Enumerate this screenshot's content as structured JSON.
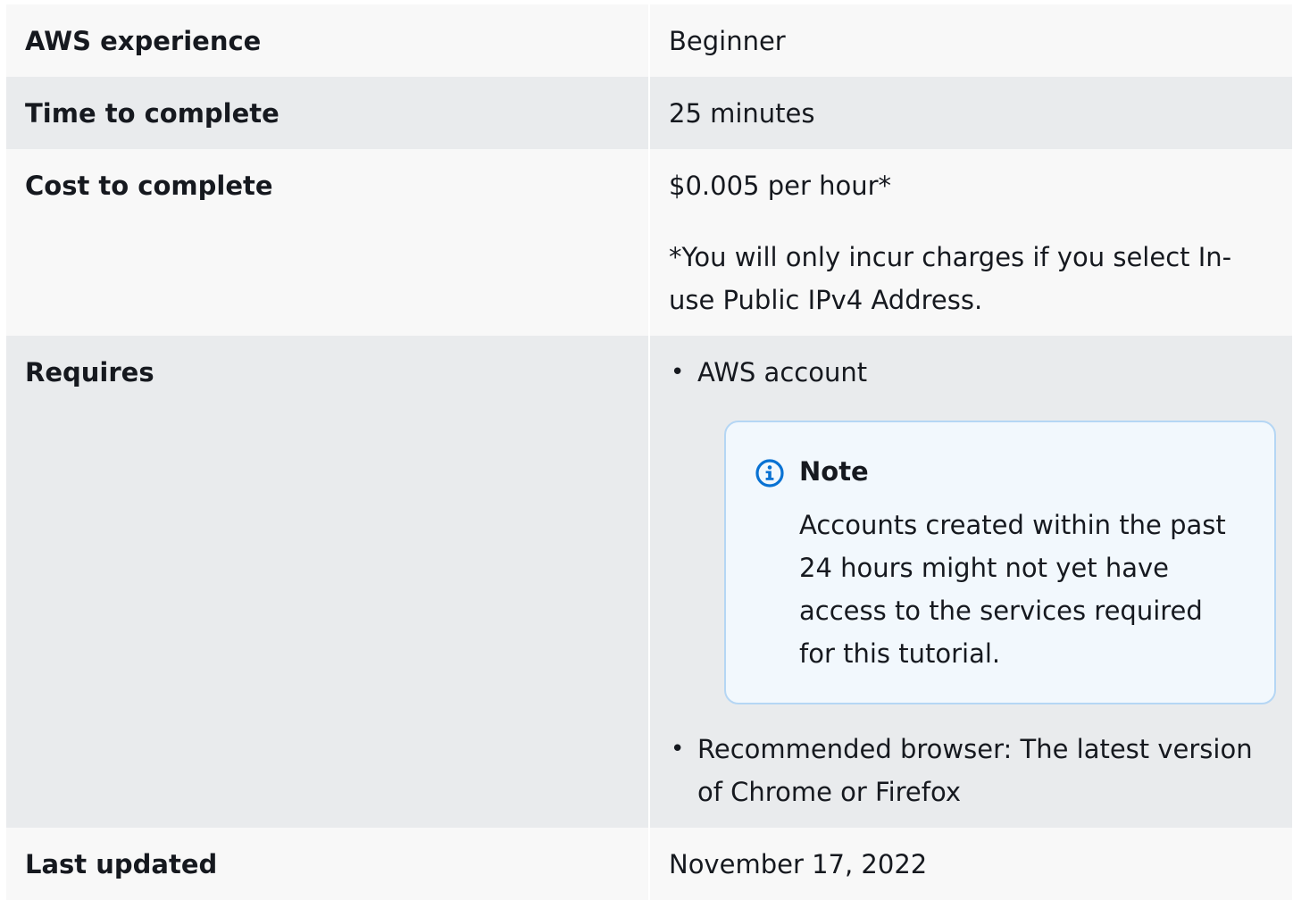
{
  "rows": [
    {
      "label": "AWS experience",
      "value": "Beginner"
    },
    {
      "label": "Time to complete",
      "value": "25 minutes"
    },
    {
      "label": "Cost to complete",
      "value": "$0.005 per hour*",
      "footnote": "*You will only incur charges if you select In-use Public IPv4 Address."
    },
    {
      "label": "Requires",
      "items": [
        "AWS account",
        "Recommended browser: The latest version of Chrome or Firefox"
      ],
      "note": {
        "icon": "info-icon",
        "title": "Note",
        "text": "Accounts created within the past 24 hours might not yet have access to the services required for this tutorial."
      }
    },
    {
      "label": "Last updated",
      "value": "November 17, 2022"
    }
  ],
  "colors": {
    "row_light": "#f8f8f8",
    "row_dark": "#e9ebed",
    "note_bg": "#f2f8fd",
    "note_border": "#b5d6f4",
    "info_icon": "#0972d3",
    "text": "#16191f"
  }
}
